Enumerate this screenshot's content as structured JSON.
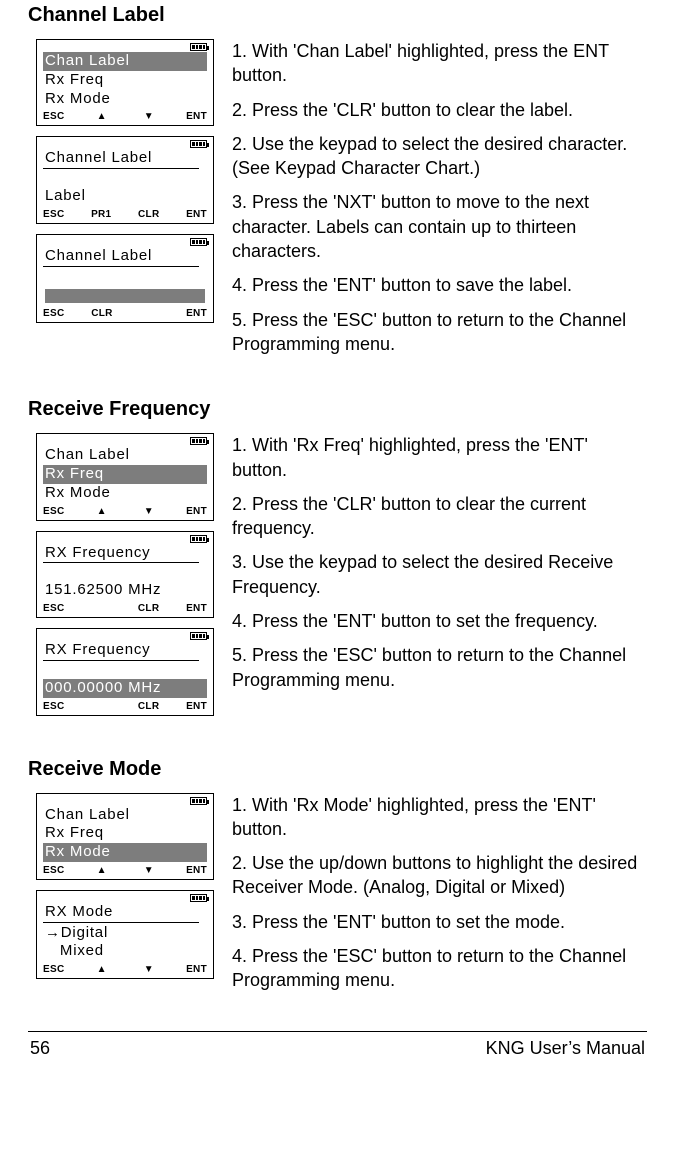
{
  "sections": {
    "channel_label": {
      "heading": "Channel Label",
      "steps": [
        "1.   With 'Chan Label' highlighted, press the ENT button.",
        "2.   Press the 'CLR' button to clear the label.",
        "2.   Use the keypad to select the desired character. (See Keypad Character Chart.)",
        "3.   Press the 'NXT' button to move to the next character. Labels can contain up to thirteen characters.",
        "4.   Press the 'ENT' button to save the label.",
        "5.   Press the 'ESC' button to return to the Channel Programming menu."
      ],
      "screens": {
        "s1": {
          "line1": "Chan Label",
          "line2": "Rx Freq",
          "line3": "Rx Mode",
          "k1": "ESC",
          "k2": "▲",
          "k3": "▼",
          "k4": "ENT"
        },
        "s2": {
          "line1": "Channel Label",
          "line3": "Label",
          "k1": "ESC",
          "k2": "PR1",
          "k3": "CLR",
          "k4": "ENT"
        },
        "s3": {
          "line1": "Channel Label",
          "k1": "ESC",
          "k2": "CLR",
          "k3": "",
          "k4": "ENT"
        }
      }
    },
    "receive_frequency": {
      "heading": "Receive Frequency",
      "steps": [
        "1.   With 'Rx Freq' highlighted, press the 'ENT' button.",
        "2.   Press the 'CLR' button to clear the current frequency.",
        "3.   Use the keypad to select the desired Receive Frequency.",
        "4.   Press the 'ENT' button to set the frequency.",
        "5.   Press the 'ESC' button to return to the Channel Programming menu."
      ],
      "screens": {
        "s1": {
          "line1": "Chan Label",
          "line2": "Rx Freq",
          "line3": "Rx Mode",
          "k1": "ESC",
          "k2": "▲",
          "k3": "▼",
          "k4": "ENT"
        },
        "s2": {
          "line1": "RX Frequency",
          "line3": "151.62500 MHz",
          "k1": "ESC",
          "k2": "",
          "k3": "CLR",
          "k4": "ENT"
        },
        "s3": {
          "line1": "RX Frequency",
          "line3": "000.00000 MHz",
          "k1": "ESC",
          "k2": "",
          "k3": "CLR",
          "k4": "ENT"
        }
      }
    },
    "receive_mode": {
      "heading": "Receive Mode",
      "steps": [
        "1.   With 'Rx Mode' highlighted, press the 'ENT' button.",
        "2.   Use the up/down buttons to highlight the desired Receiver Mode. (Analog, Digital or Mixed)",
        "3.   Press the 'ENT' button to set the mode.",
        "4.   Press the 'ESC' button to return to the Channel Programming menu."
      ],
      "screens": {
        "s1": {
          "line1": "Chan Label",
          "line2": "Rx Freq",
          "line3": "Rx Mode",
          "k1": "ESC",
          "k2": "▲",
          "k3": "▼",
          "k4": "ENT"
        },
        "s2": {
          "line1": "RX Mode",
          "line2": "→Digital",
          "line3": "   Mixed",
          "k1": "ESC",
          "k2": "▲",
          "k3": "▼",
          "k4": "ENT"
        }
      }
    }
  },
  "footer": {
    "page": "56",
    "title": "KNG User’s Manual"
  }
}
